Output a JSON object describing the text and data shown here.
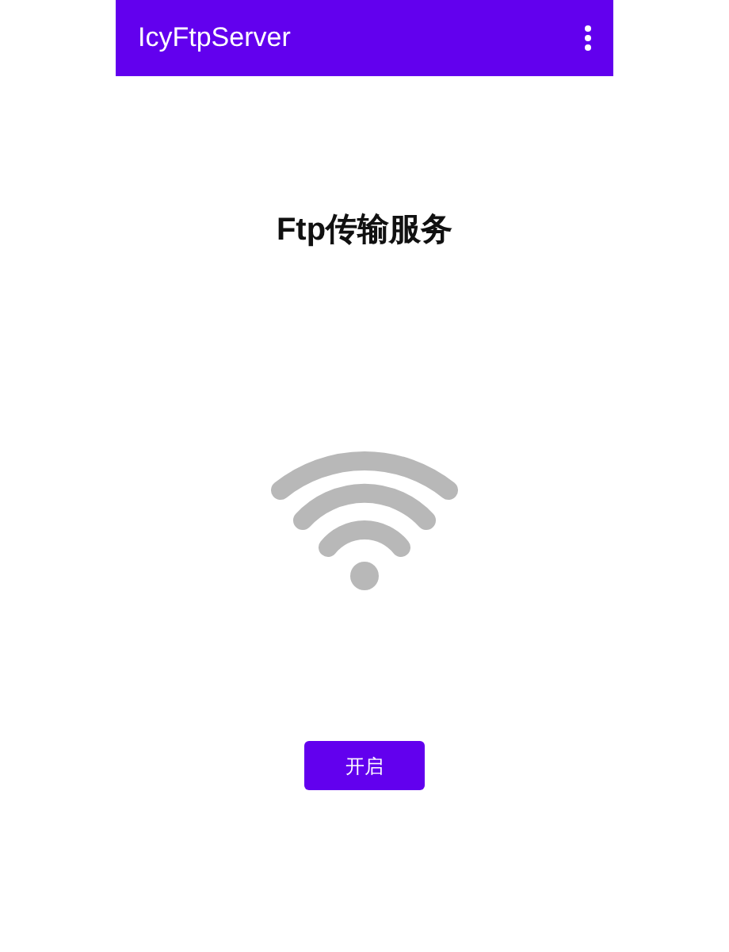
{
  "app_bar": {
    "title": "IcyFtpServer"
  },
  "heading": "Ftp传输服务",
  "button": {
    "label": "开启"
  }
}
